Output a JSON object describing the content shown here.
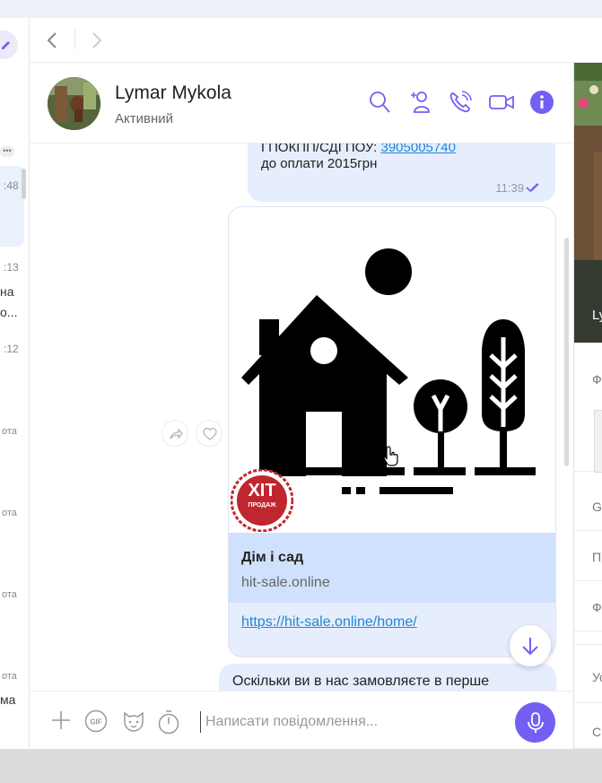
{
  "contact": {
    "name": "Lymar Mykola",
    "status": "Активний"
  },
  "chat_list": {
    "stubs": [
      ":48",
      ":13",
      "на",
      "о...",
      ":12",
      "ота",
      "ота",
      "ота",
      "ота",
      "ма"
    ]
  },
  "messages": {
    "first": {
      "top_text": "ГПОКПП/СДГПОУ:",
      "top_link": "3905005740",
      "text": "до оплати 2015грн",
      "time": "11:39"
    },
    "link_card": {
      "badge_big": "ХІТ",
      "badge_small": "ПРОДАЖ",
      "title": "Дім і сад",
      "domain": "hit-sale.online",
      "url": "https://hit-sale.online/home/"
    },
    "last": {
      "text": "Оскільки ви в нас замовляєте в перше"
    }
  },
  "composer": {
    "placeholder": "Написати повідомлення..."
  },
  "right_pane": {
    "caption": "Ly",
    "rows": [
      "Ф",
      "G",
      "П",
      "Ф",
      "Ус",
      "С"
    ]
  },
  "colors": {
    "accent": "#7360f2",
    "bubble": "#e6edfd",
    "link": "#1e87d6"
  }
}
